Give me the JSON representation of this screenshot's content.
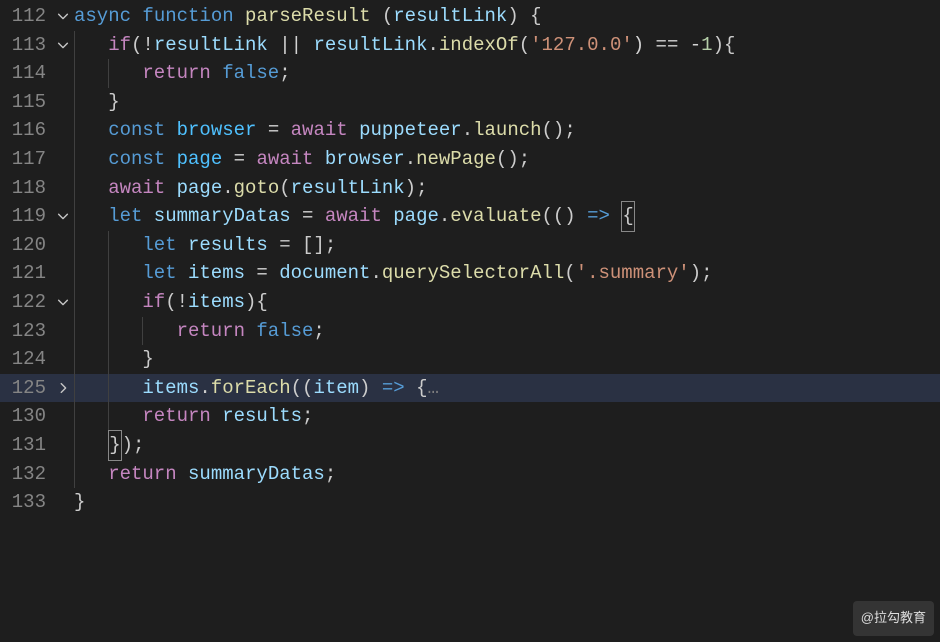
{
  "watermark": "@拉勾教育",
  "lines": [
    {
      "n": "112",
      "fold": "down",
      "highlighted": false,
      "indent": 0,
      "tokens": [
        {
          "t": "async ",
          "c": "kw"
        },
        {
          "t": "function ",
          "c": "kw"
        },
        {
          "t": "parseResult ",
          "c": "fn"
        },
        {
          "t": "(",
          "c": "pn"
        },
        {
          "t": "resultLink",
          "c": "id"
        },
        {
          "t": ") {",
          "c": "pn"
        }
      ]
    },
    {
      "n": "113",
      "fold": "down",
      "highlighted": false,
      "indent": 1,
      "tokens": [
        {
          "t": "if",
          "c": "kwc"
        },
        {
          "t": "(!",
          "c": "pn"
        },
        {
          "t": "resultLink",
          "c": "id"
        },
        {
          "t": " || ",
          "c": "op"
        },
        {
          "t": "resultLink",
          "c": "id"
        },
        {
          "t": ".",
          "c": "pn"
        },
        {
          "t": "indexOf",
          "c": "fn"
        },
        {
          "t": "(",
          "c": "pn"
        },
        {
          "t": "'127.0.0'",
          "c": "str"
        },
        {
          "t": ") == ",
          "c": "op"
        },
        {
          "t": "-",
          "c": "op"
        },
        {
          "t": "1",
          "c": "num"
        },
        {
          "t": "){",
          "c": "pn"
        }
      ]
    },
    {
      "n": "114",
      "fold": "",
      "highlighted": false,
      "indent": 2,
      "tokens": [
        {
          "t": "return ",
          "c": "kwc"
        },
        {
          "t": "false",
          "c": "bool"
        },
        {
          "t": ";",
          "c": "pn"
        }
      ]
    },
    {
      "n": "115",
      "fold": "",
      "highlighted": false,
      "indent": 1,
      "tokens": [
        {
          "t": "}",
          "c": "pn"
        }
      ]
    },
    {
      "n": "116",
      "fold": "",
      "highlighted": false,
      "indent": 1,
      "tokens": [
        {
          "t": "const ",
          "c": "kw"
        },
        {
          "t": "browser",
          "c": "cst"
        },
        {
          "t": " = ",
          "c": "op"
        },
        {
          "t": "await ",
          "c": "kwc"
        },
        {
          "t": "puppeteer",
          "c": "id"
        },
        {
          "t": ".",
          "c": "pn"
        },
        {
          "t": "launch",
          "c": "fn"
        },
        {
          "t": "();",
          "c": "pn"
        }
      ]
    },
    {
      "n": "117",
      "fold": "",
      "highlighted": false,
      "indent": 1,
      "tokens": [
        {
          "t": "const ",
          "c": "kw"
        },
        {
          "t": "page",
          "c": "cst"
        },
        {
          "t": " = ",
          "c": "op"
        },
        {
          "t": "await ",
          "c": "kwc"
        },
        {
          "t": "browser",
          "c": "id"
        },
        {
          "t": ".",
          "c": "pn"
        },
        {
          "t": "newPage",
          "c": "fn"
        },
        {
          "t": "();",
          "c": "pn"
        }
      ]
    },
    {
      "n": "118",
      "fold": "",
      "highlighted": false,
      "indent": 1,
      "tokens": [
        {
          "t": "await ",
          "c": "kwc"
        },
        {
          "t": "page",
          "c": "id"
        },
        {
          "t": ".",
          "c": "pn"
        },
        {
          "t": "goto",
          "c": "fn"
        },
        {
          "t": "(",
          "c": "pn"
        },
        {
          "t": "resultLink",
          "c": "id"
        },
        {
          "t": ");",
          "c": "pn"
        }
      ]
    },
    {
      "n": "119",
      "fold": "down",
      "highlighted": false,
      "indent": 1,
      "tokens": [
        {
          "t": "let ",
          "c": "kw"
        },
        {
          "t": "summaryDatas",
          "c": "id"
        },
        {
          "t": " = ",
          "c": "op"
        },
        {
          "t": "await ",
          "c": "kwc"
        },
        {
          "t": "page",
          "c": "id"
        },
        {
          "t": ".",
          "c": "pn"
        },
        {
          "t": "evaluate",
          "c": "fn"
        },
        {
          "t": "(() ",
          "c": "pn"
        },
        {
          "t": "=>",
          "c": "arrow"
        },
        {
          "t": " ",
          "c": "pn"
        },
        {
          "t": "{",
          "c": "pn",
          "hl": true
        }
      ]
    },
    {
      "n": "120",
      "fold": "",
      "highlighted": false,
      "indent": 2,
      "tokens": [
        {
          "t": "let ",
          "c": "kw"
        },
        {
          "t": "results",
          "c": "id"
        },
        {
          "t": " = [];",
          "c": "pn"
        }
      ]
    },
    {
      "n": "121",
      "fold": "",
      "highlighted": false,
      "indent": 2,
      "tokens": [
        {
          "t": "let ",
          "c": "kw"
        },
        {
          "t": "items",
          "c": "id"
        },
        {
          "t": " = ",
          "c": "op"
        },
        {
          "t": "document",
          "c": "id"
        },
        {
          "t": ".",
          "c": "pn"
        },
        {
          "t": "querySelectorAll",
          "c": "fn"
        },
        {
          "t": "(",
          "c": "pn"
        },
        {
          "t": "'.summary'",
          "c": "str"
        },
        {
          "t": ");",
          "c": "pn"
        }
      ]
    },
    {
      "n": "122",
      "fold": "down",
      "highlighted": false,
      "indent": 2,
      "tokens": [
        {
          "t": "if",
          "c": "kwc"
        },
        {
          "t": "(!",
          "c": "pn"
        },
        {
          "t": "items",
          "c": "id"
        },
        {
          "t": "){",
          "c": "pn"
        }
      ]
    },
    {
      "n": "123",
      "fold": "",
      "highlighted": false,
      "indent": 3,
      "tokens": [
        {
          "t": "return ",
          "c": "kwc"
        },
        {
          "t": "false",
          "c": "bool"
        },
        {
          "t": ";",
          "c": "pn"
        }
      ]
    },
    {
      "n": "124",
      "fold": "",
      "highlighted": false,
      "indent": 2,
      "tokens": [
        {
          "t": "}",
          "c": "pn"
        }
      ]
    },
    {
      "n": "125",
      "fold": "right",
      "highlighted": true,
      "indent": 2,
      "tokens": [
        {
          "t": "items",
          "c": "id"
        },
        {
          "t": ".",
          "c": "pn"
        },
        {
          "t": "forEach",
          "c": "fn"
        },
        {
          "t": "((",
          "c": "pn"
        },
        {
          "t": "item",
          "c": "id"
        },
        {
          "t": ") ",
          "c": "pn"
        },
        {
          "t": "=>",
          "c": "arrow"
        },
        {
          "t": " {",
          "c": "pn"
        },
        {
          "t": "…",
          "c": "dim"
        }
      ]
    },
    {
      "n": "130",
      "fold": "",
      "highlighted": false,
      "indent": 2,
      "tokens": [
        {
          "t": "return ",
          "c": "kwc"
        },
        {
          "t": "results",
          "c": "id"
        },
        {
          "t": ";",
          "c": "pn"
        }
      ]
    },
    {
      "n": "131",
      "fold": "",
      "highlighted": false,
      "indent": 1,
      "tokens": [
        {
          "t": "}",
          "c": "pn",
          "hl": true
        },
        {
          "t": ");",
          "c": "pn"
        }
      ]
    },
    {
      "n": "132",
      "fold": "",
      "highlighted": false,
      "indent": 1,
      "tokens": [
        {
          "t": "return ",
          "c": "kwc"
        },
        {
          "t": "summaryDatas",
          "c": "id"
        },
        {
          "t": ";",
          "c": "pn"
        }
      ]
    },
    {
      "n": "133",
      "fold": "",
      "highlighted": false,
      "indent": 0,
      "tokens": [
        {
          "t": "}",
          "c": "pn"
        }
      ]
    }
  ]
}
